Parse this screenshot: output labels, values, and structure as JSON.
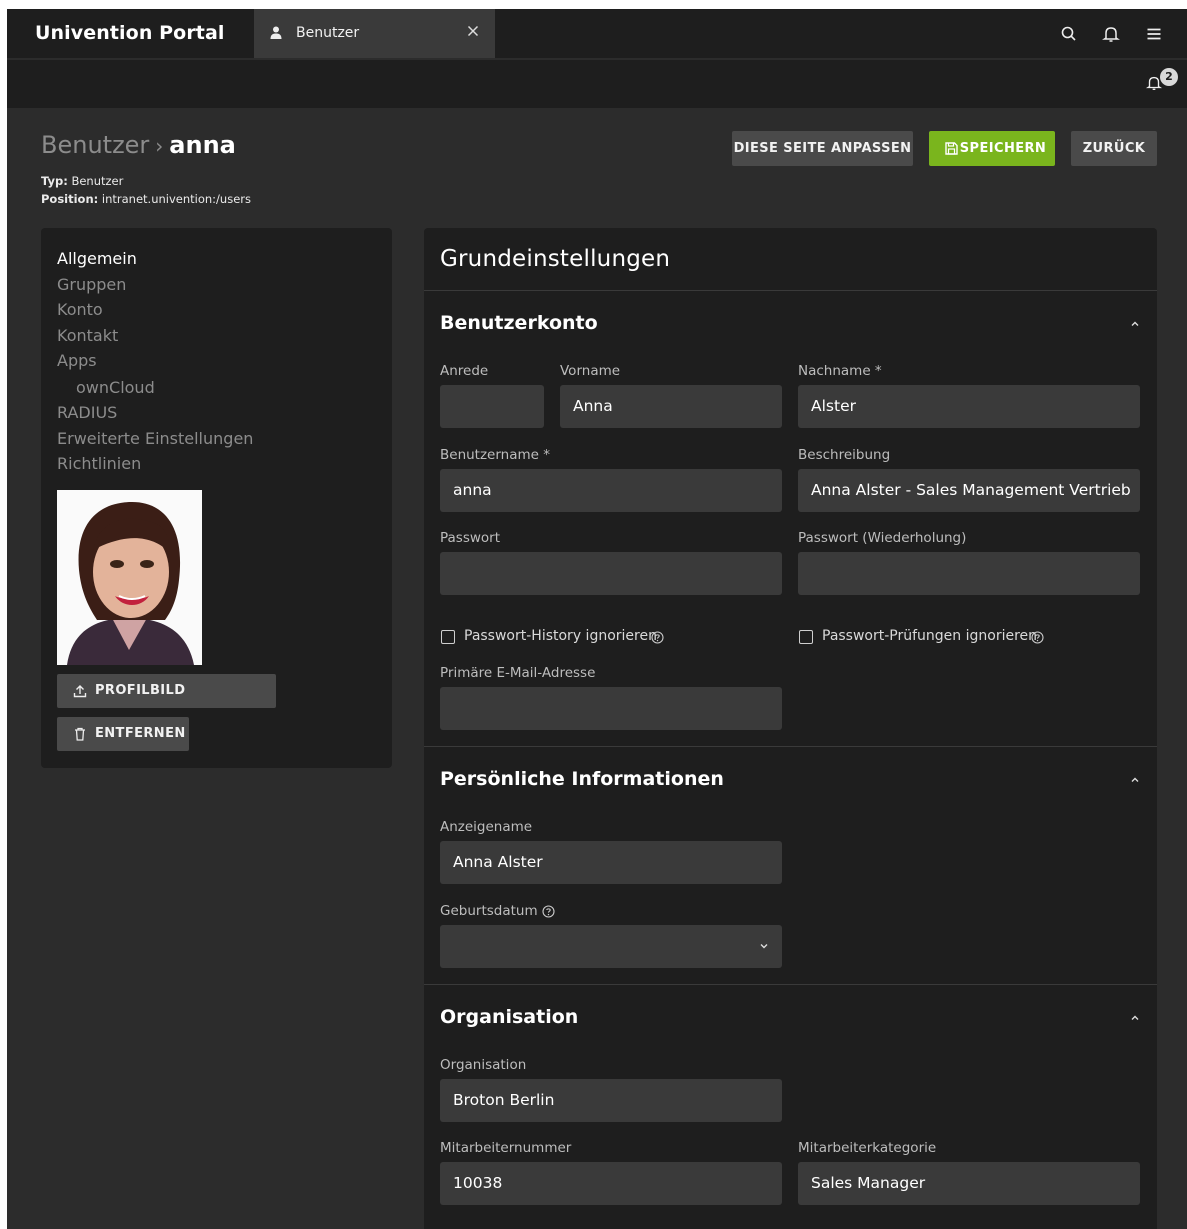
{
  "header": {
    "app_title": "Univention Portal",
    "tab": {
      "label": "Benutzer",
      "icon": "user-icon",
      "close_icon": "close-icon"
    },
    "icons": [
      "search-icon",
      "bell-icon",
      "menu-icon"
    ]
  },
  "subbar": {
    "notification_count": "2"
  },
  "page": {
    "breadcrumb_parent": "Benutzer",
    "breadcrumb_separator": "›",
    "breadcrumb_current": "anna",
    "type_label": "Typ:",
    "type_value": "Benutzer",
    "position_label": "Position:",
    "position_value": "intranet.univention:/users"
  },
  "toolbar": {
    "customize_label": "DIESE SEITE ANPASSEN",
    "save_label": "SPEICHERN",
    "back_label": "ZURÜCK"
  },
  "colors": {
    "accent": "#7ab51d",
    "background": "#2c2c2c",
    "panel": "#1e1e1e",
    "field": "#3a3a3a"
  },
  "sidebar": {
    "items": [
      {
        "label": "Allgemein",
        "active": true
      },
      {
        "label": "Gruppen"
      },
      {
        "label": "Konto"
      },
      {
        "label": "Kontakt"
      },
      {
        "label": "Apps"
      },
      {
        "label": "ownCloud",
        "indent": true
      },
      {
        "label": "RADIUS"
      },
      {
        "label": "Erweiterte Einstellungen"
      },
      {
        "label": "Richtlinien"
      }
    ],
    "upload_label": "PROFILBILD HOCHLADEN",
    "remove_label": "ENTFERNEN"
  },
  "main": {
    "title": "Grundeinstellungen",
    "account": {
      "title": "Benutzerkonto",
      "salutation_label": "Anrede",
      "salutation_value": "",
      "firstname_label": "Vorname",
      "firstname_value": "Anna",
      "lastname_label": "Nachname *",
      "lastname_value": "Alster",
      "username_label": "Benutzername *",
      "username_value": "anna",
      "description_label": "Beschreibung",
      "description_value": "Anna Alster - Sales Management Vertrieb",
      "password_label": "Passwort",
      "password_value": "",
      "password_repeat_label": "Passwort (Wiederholung)",
      "password_repeat_value": "",
      "history_label": "Passwort-History ignorieren",
      "history_checked": false,
      "checks_label": "Passwort-Prüfungen ignorieren",
      "checks_checked": false,
      "email_label": "Primäre E-Mail-Adresse",
      "email_value": ""
    },
    "personal": {
      "title": "Persönliche Informationen",
      "displayname_label": "Anzeigename",
      "displayname_value": "Anna Alster",
      "birthdate_label": "Geburtsdatum",
      "birthdate_value": ""
    },
    "organisation": {
      "title": "Organisation",
      "org_label": "Organisation",
      "org_value": "Broton Berlin",
      "employee_number_label": "Mitarbeiternummer",
      "employee_number_value": "10038",
      "employee_category_label": "Mitarbeiterkategorie",
      "employee_category_value": "Sales Manager"
    }
  }
}
